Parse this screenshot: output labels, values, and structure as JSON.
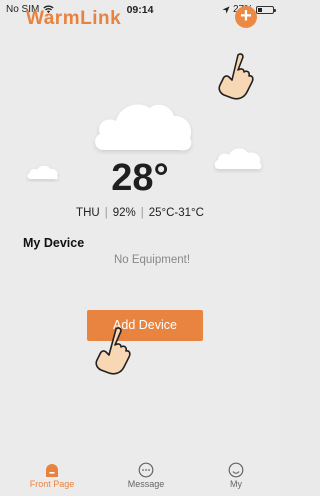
{
  "status_bar": {
    "carrier": "No SIM",
    "time": "09:14",
    "battery": "27%",
    "battery_level": 0.27
  },
  "header": {
    "brand": "WarmLink",
    "add_icon": "plus-circle-icon"
  },
  "weather": {
    "temperature": "28°",
    "day": "THU",
    "humidity": "92%",
    "range": "25°C-31°C"
  },
  "devices": {
    "title": "My Device",
    "empty_text": "No Equipment!",
    "add_button": "Add Device"
  },
  "tabbar": {
    "items": [
      {
        "label": "Front Page",
        "icon": "home-icon",
        "active": true
      },
      {
        "label": "Message",
        "icon": "message-icon",
        "active": false
      },
      {
        "label": "My",
        "icon": "profile-icon",
        "active": false
      }
    ]
  },
  "colors": {
    "accent": "#e8833f",
    "background": "#ebebeb"
  }
}
